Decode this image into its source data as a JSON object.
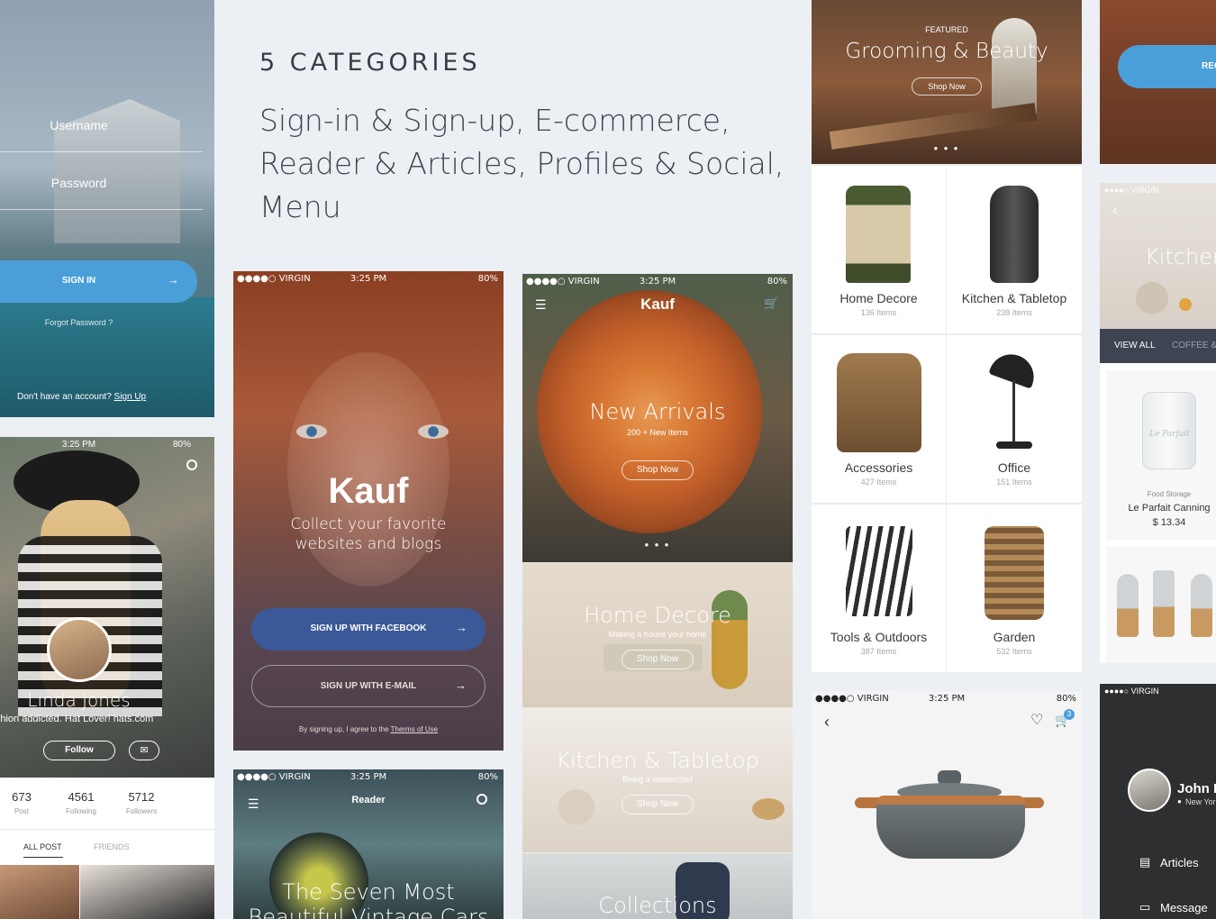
{
  "intro": {
    "heading": "5 CATEGORIES",
    "body": "Sign-in & Sign-up, E-commerce, Reader & Articles, Profiles & Social, Menu"
  },
  "signin": {
    "username": "Username",
    "password": "Password",
    "button": "SIGN IN",
    "forgot": "Forgot Password ?",
    "no_account": "Don't have an account?",
    "signup_link": "Sign Up"
  },
  "profile": {
    "time": "3:25 PM",
    "battery": "80%",
    "name": "Linda Jones",
    "bio": "Fashion addicted. Hat Lover! hats.com",
    "follow": "Follow",
    "stats": [
      {
        "n": "673",
        "l": "Post"
      },
      {
        "n": "4561",
        "l": "Following"
      },
      {
        "n": "5712",
        "l": "Followers"
      }
    ],
    "tabs": [
      "ALL POST",
      "FRIENDS"
    ]
  },
  "signup": {
    "carrier": "●●●●○ VIRGIN",
    "time": "3:25 PM",
    "battery": "80%",
    "brand": "Kauf",
    "tagline": "Collect your favorite websites and blogs",
    "fb": "SIGN UP WITH FACEBOOK",
    "email": "SIGN UP WITH E-MAIL",
    "terms_prefix": "By signing up, I agree to the",
    "terms_link": "Therms of Use"
  },
  "reader": {
    "carrier": "●●●●○ VIRGIN",
    "time": "3:25 PM",
    "battery": "80%",
    "title": "Reader",
    "headline": "The Seven Most Beautiful Vintage Cars"
  },
  "shop": {
    "carrier": "●●●●○ VIRGIN",
    "time": "3:25 PM",
    "battery": "80%",
    "brand": "Kauf",
    "hero_title": "New Arrivals",
    "hero_sub": "200 + New Items",
    "shop_now": "Shop Now",
    "cats": [
      {
        "title": "Home Decore",
        "sub": "Making a house your home"
      },
      {
        "title": "Kitchen & Tabletop",
        "sub": "Being a masterchef"
      },
      {
        "title": "Collections",
        "sub": ""
      }
    ]
  },
  "grid": {
    "featured": "FEATURED",
    "banner": "Grooming & Beauty",
    "shop_now": "Shop Now",
    "items": [
      {
        "name": "Home Decore",
        "count": "136 Items"
      },
      {
        "name": "Kitchen & Tabletop",
        "count": "238 Items"
      },
      {
        "name": "Accessories",
        "count": "427 Items"
      },
      {
        "name": "Office",
        "count": "151 Items"
      },
      {
        "name": "Tools & Outdoors",
        "count": "387 Items"
      },
      {
        "name": "Garden",
        "count": "532 Items"
      }
    ]
  },
  "product": {
    "carrier": "●●●●○ VIRGIN",
    "time": "3:25 PM",
    "battery": "80%",
    "cart_count": "3"
  },
  "right": {
    "btn": "REG",
    "carrier": "●●●●○ VIRGIN",
    "title": "Kitchen",
    "view_all": "VIEW ALL",
    "coffee": "COFFEE &",
    "product_cat": "Food Storage",
    "product_name": "Le Parfait Canning",
    "price": "$ 13.34",
    "jar_text": "Le Parfait"
  },
  "menu": {
    "carrier": "●●●●○ VIRGIN",
    "name": "John D",
    "location": "New Yor",
    "items": [
      "Articles",
      "Message"
    ]
  },
  "colors": {
    "accent": "#4a9fd9",
    "facebook": "#3b5998",
    "bg": "#eceff4"
  }
}
